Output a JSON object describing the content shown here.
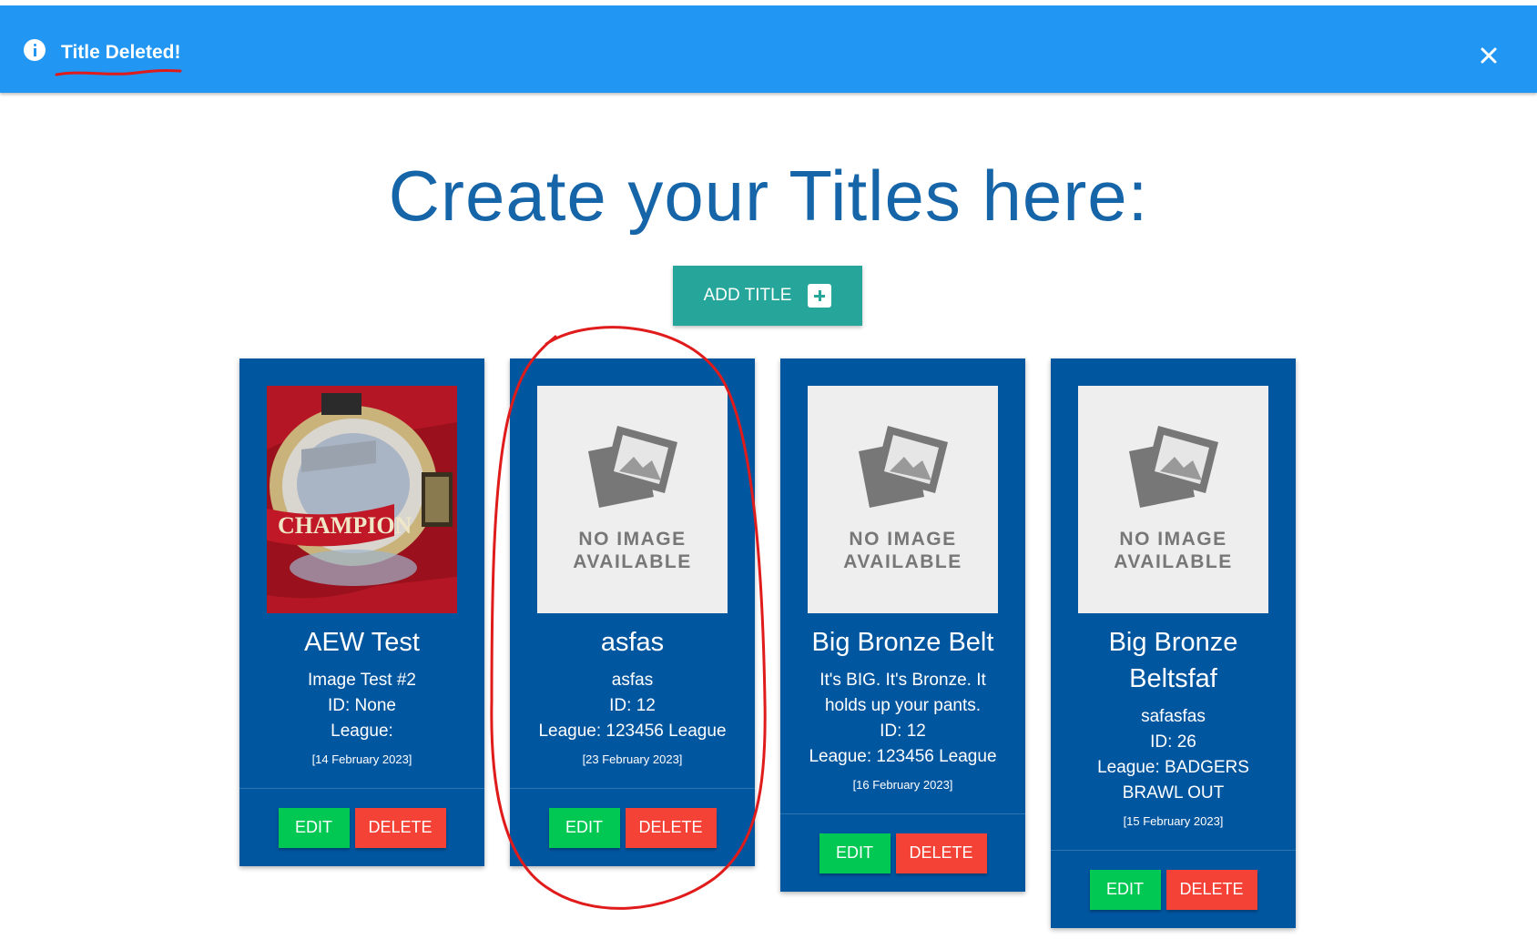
{
  "banner": {
    "message": "Title Deleted!",
    "icon": "info-icon",
    "close_icon": "close-icon",
    "color": "#2196f3"
  },
  "page": {
    "title": "Create your Titles here:",
    "add_button_label": "ADD TITLE",
    "add_button_icon": "plus-icon"
  },
  "cards": [
    {
      "name": "AEW Test",
      "description": "Image Test #2",
      "id": "ID: None",
      "league": "League:",
      "date": "[14 February 2023]",
      "image": "belt-photo",
      "photo_text": "CHAMPION",
      "edit_label": "EDIT",
      "delete_label": "DELETE"
    },
    {
      "name": "asfas",
      "description": "asfas",
      "id": "ID: 12",
      "league": "League: 123456 League",
      "date": "[23 February 2023]",
      "image_text_1": "NO IMAGE",
      "image_text_2": "AVAILABLE",
      "edit_label": "EDIT",
      "delete_label": "DELETE"
    },
    {
      "name": "Big Bronze Belt",
      "description": "It's BIG. It's Bronze. It holds up your pants.",
      "id": "ID: 12",
      "league": "League: 123456 League",
      "date": "[16 February 2023]",
      "image_text_1": "NO IMAGE",
      "image_text_2": "AVAILABLE",
      "edit_label": "EDIT",
      "delete_label": "DELETE"
    },
    {
      "name": "Big Bronze Beltsfaf",
      "description": "safasfas",
      "id": "ID: 26",
      "league": "League: BADGERS BRAWL OUT",
      "date": "[15 February 2023]",
      "image_text_1": "NO IMAGE",
      "image_text_2": "AVAILABLE",
      "edit_label": "EDIT",
      "delete_label": "DELETE"
    }
  ],
  "colors": {
    "card_bg": "#0156a0",
    "title_color": "#1565a8",
    "add_button": "#26a69a",
    "edit_button": "#00c853",
    "delete_button": "#f44336",
    "annotation": "#e01b1b"
  }
}
